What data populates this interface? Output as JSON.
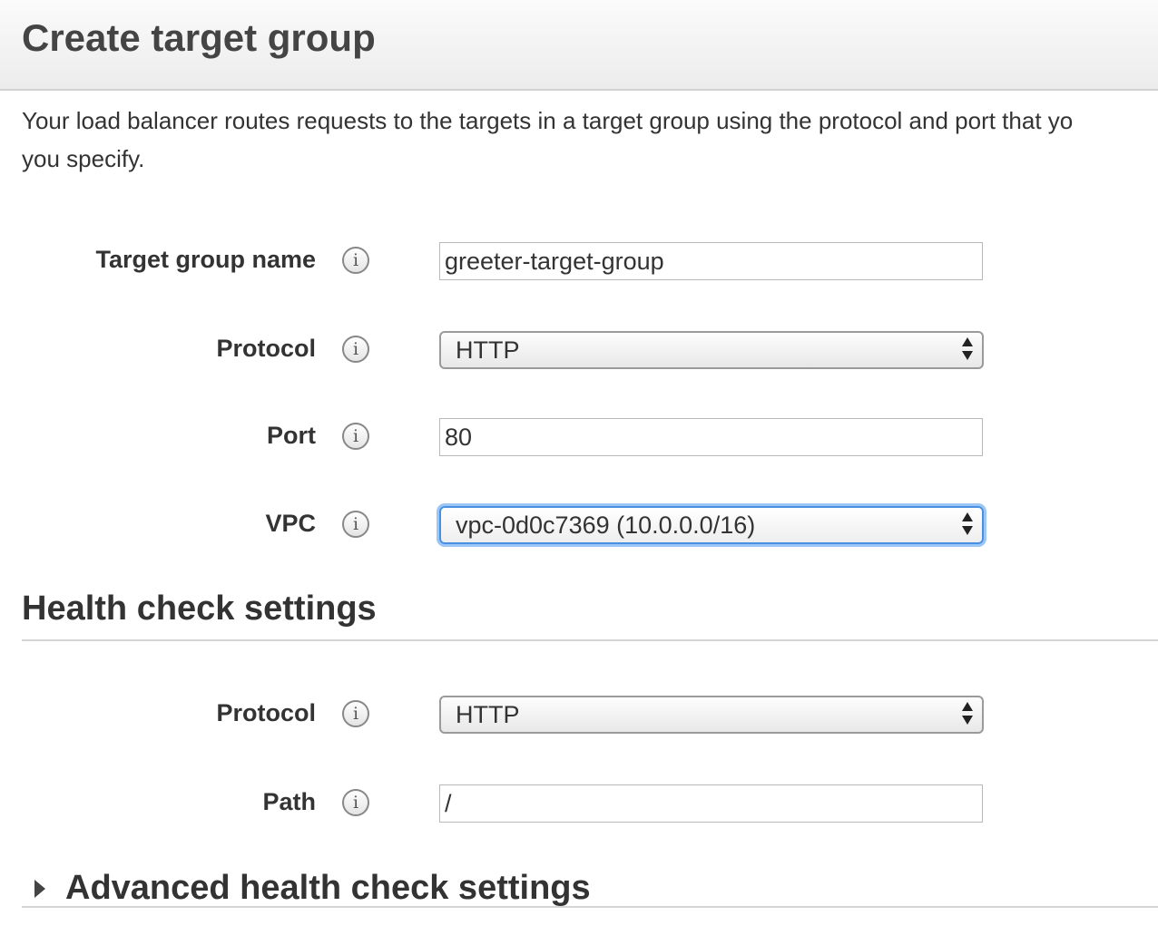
{
  "header": {
    "title": "Create target group"
  },
  "description": {
    "line1": "Your load balancer routes requests to the targets in a target group using the protocol and port that yo",
    "line2": "you specify."
  },
  "target_group": {
    "name_label": "Target group name",
    "name_value": "greeter-target-group",
    "protocol_label": "Protocol",
    "protocol_value": "HTTP",
    "port_label": "Port",
    "port_value": "80",
    "vpc_label": "VPC",
    "vpc_value": "vpc-0d0c7369 (10.0.0.0/16)"
  },
  "health_check": {
    "title": "Health check settings",
    "protocol_label": "Protocol",
    "protocol_value": "HTTP",
    "path_label": "Path",
    "path_value": "/"
  },
  "advanced": {
    "title": "Advanced health check settings",
    "expanded": false
  },
  "icons": {
    "info": "info-icon",
    "select_arrows": "select-arrows-icon",
    "caret": "caret-right-icon"
  },
  "colors": {
    "focus_ring": "#4a90e2",
    "header_bg": "#ececec"
  }
}
